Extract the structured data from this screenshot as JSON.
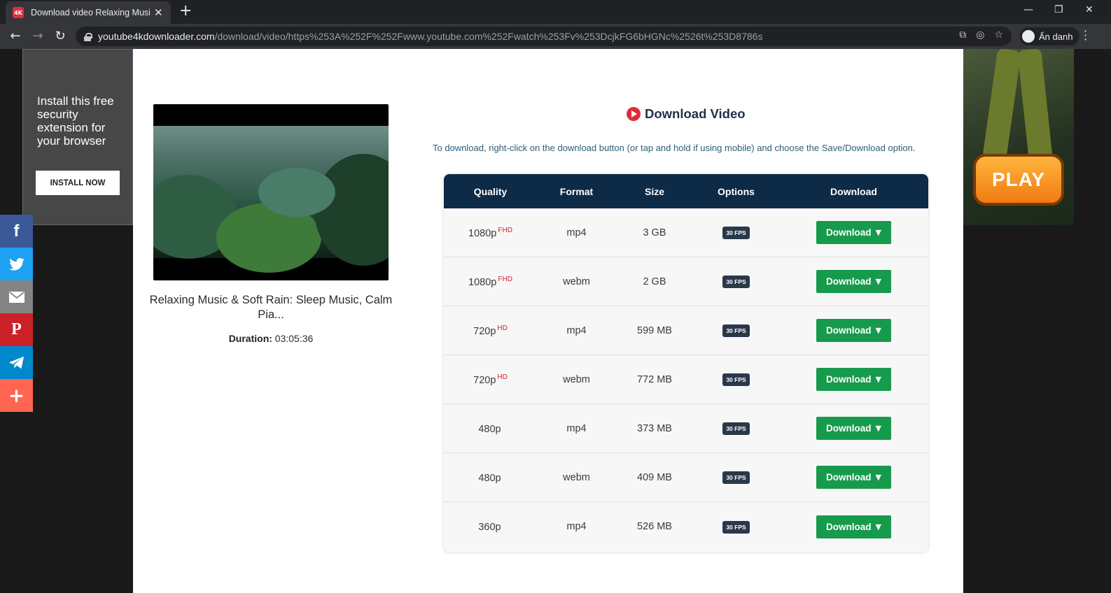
{
  "browser": {
    "tab_title": "Download video Relaxing Music & Soft Rain: Sleep Music, Calm Pia...",
    "tab_favicon_text": "4K",
    "url_host": "youtube4kdownloader.com",
    "url_path": "/download/video/https%253A%252F%252Fwww.youtube.com%252Fwatch%253Fv%253DcjkFG6bHGNc%2526t%253D8786s",
    "profile_label": "Ẩn danh"
  },
  "ad_left": {
    "text": "Install this free security extension for your browser",
    "button": "INSTALL NOW"
  },
  "ad_right": {
    "button": "PLAY"
  },
  "video": {
    "title": "Relaxing Music & Soft Rain: Sleep Music, Calm Pia...",
    "duration_label": "Duration:",
    "duration_value": "03:05:36"
  },
  "download": {
    "heading": "Download Video",
    "instruction": "To download, right-click on the download button (or tap and hold if using mobile) and choose the Save/Download option.",
    "columns": [
      "Quality",
      "Format",
      "Size",
      "Options",
      "Download"
    ],
    "rows": [
      {
        "quality": "1080p",
        "badge": "FHD",
        "format": "mp4",
        "size": "3 GB",
        "fps": "30 FPS",
        "button": "Download"
      },
      {
        "quality": "1080p",
        "badge": "FHD",
        "format": "webm",
        "size": "2 GB",
        "fps": "30 FPS",
        "button": "Download"
      },
      {
        "quality": "720p",
        "badge": "HD",
        "format": "mp4",
        "size": "599 MB",
        "fps": "30 FPS",
        "button": "Download"
      },
      {
        "quality": "720p",
        "badge": "HD",
        "format": "webm",
        "size": "772 MB",
        "fps": "30 FPS",
        "button": "Download"
      },
      {
        "quality": "480p",
        "badge": "",
        "format": "mp4",
        "size": "373 MB",
        "fps": "30 FPS",
        "button": "Download"
      },
      {
        "quality": "480p",
        "badge": "",
        "format": "webm",
        "size": "409 MB",
        "fps": "30 FPS",
        "button": "Download"
      },
      {
        "quality": "360p",
        "badge": "",
        "format": "mp4",
        "size": "526 MB",
        "fps": "30 FPS",
        "button": "Download"
      }
    ]
  },
  "share": [
    "facebook-icon",
    "twitter-icon",
    "email-icon",
    "pinterest-icon",
    "telegram-icon",
    "more-icon"
  ],
  "colors": {
    "header_navy": "#0d2a47",
    "download_green": "#169a4c",
    "badge_red": "#d3202e",
    "heading_text": "#1f3146"
  }
}
